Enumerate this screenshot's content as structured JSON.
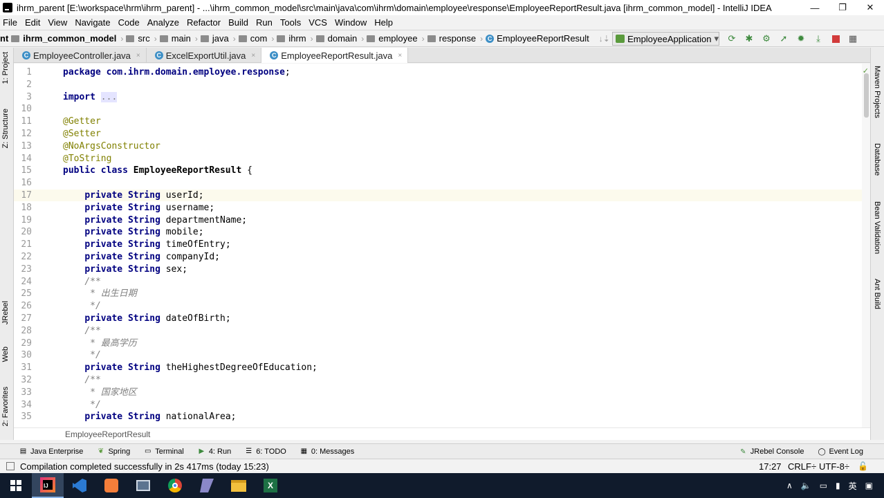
{
  "window": {
    "title": "ihrm_parent [E:\\workspace\\hrm\\ihrm_parent] - ...\\ihrm_common_model\\src\\main\\java\\com\\ihrm\\domain\\employee\\response\\EmployeeReportResult.java [ihrm_common_model] - IntelliJ IDEA",
    "minimize": "—",
    "restore": "❐",
    "close": "✕"
  },
  "menu": [
    "File",
    "Edit",
    "View",
    "Navigate",
    "Code",
    "Analyze",
    "Refactor",
    "Build",
    "Run",
    "Tools",
    "VCS",
    "Window",
    "Help"
  ],
  "nav": {
    "first": "nt",
    "module": "ihrm_common_model",
    "crumbs": [
      "src",
      "main",
      "java",
      "com",
      "ihrm",
      "domain",
      "employee",
      "response"
    ],
    "class": "EmployeeReportResult",
    "run_config": "EmployeeApplication"
  },
  "left_tabs": [
    "1: Project",
    "Z: Structure",
    "JRebel",
    "Web",
    "2: Favorites"
  ],
  "right_tabs": [
    "Maven Projects",
    "Database",
    "Bean Validation",
    "Ant Build"
  ],
  "tabs": [
    {
      "label": "EmployeeController.java",
      "active": false
    },
    {
      "label": "ExcelExportUtil.java",
      "active": false
    },
    {
      "label": "EmployeeReportResult.java",
      "active": true
    }
  ],
  "code": [
    {
      "n": "1",
      "parts": [
        [
          "kw",
          "package "
        ],
        [
          "kw",
          "com.ihrm.domain.employee.response"
        ],
        [
          "",
          "; "
        ]
      ]
    },
    {
      "n": "2",
      "parts": []
    },
    {
      "n": "3",
      "parts": [
        [
          "kw",
          "import "
        ],
        [
          "fold",
          "..."
        ]
      ]
    },
    {
      "n": "10",
      "parts": []
    },
    {
      "n": "11",
      "parts": [
        [
          "ann",
          "@Getter"
        ]
      ]
    },
    {
      "n": "12",
      "parts": [
        [
          "ann",
          "@Setter"
        ]
      ]
    },
    {
      "n": "13",
      "parts": [
        [
          "ann",
          "@NoArgsConstructor"
        ]
      ]
    },
    {
      "n": "14",
      "parts": [
        [
          "ann",
          "@ToString"
        ]
      ]
    },
    {
      "n": "15",
      "parts": [
        [
          "kw",
          "public class "
        ],
        [
          "b",
          "EmployeeReportResult"
        ],
        [
          "",
          " {"
        ]
      ]
    },
    {
      "n": "16",
      "parts": []
    },
    {
      "n": "17",
      "parts": [
        [
          "",
          "    "
        ],
        [
          "kw",
          "private "
        ],
        [
          "kw",
          "String "
        ],
        [
          "",
          "userId;"
        ]
      ],
      "current": true
    },
    {
      "n": "18",
      "parts": [
        [
          "",
          "    "
        ],
        [
          "kw",
          "private "
        ],
        [
          "kw",
          "String "
        ],
        [
          "",
          "username;"
        ]
      ]
    },
    {
      "n": "19",
      "parts": [
        [
          "",
          "    "
        ],
        [
          "kw",
          "private "
        ],
        [
          "kw",
          "String "
        ],
        [
          "",
          "departmentName;"
        ]
      ]
    },
    {
      "n": "20",
      "parts": [
        [
          "",
          "    "
        ],
        [
          "kw",
          "private "
        ],
        [
          "kw",
          "String "
        ],
        [
          "",
          "mobile;"
        ]
      ]
    },
    {
      "n": "21",
      "parts": [
        [
          "",
          "    "
        ],
        [
          "kw",
          "private "
        ],
        [
          "kw",
          "String "
        ],
        [
          "",
          "timeOfEntry;"
        ]
      ]
    },
    {
      "n": "22",
      "parts": [
        [
          "",
          "    "
        ],
        [
          "kw",
          "private "
        ],
        [
          "kw",
          "String "
        ],
        [
          "",
          "companyId;"
        ]
      ]
    },
    {
      "n": "23",
      "parts": [
        [
          "",
          "    "
        ],
        [
          "kw",
          "private "
        ],
        [
          "kw",
          "String "
        ],
        [
          "",
          "sex;"
        ]
      ]
    },
    {
      "n": "24",
      "parts": [
        [
          "",
          "    "
        ],
        [
          "cm",
          "/**"
        ]
      ]
    },
    {
      "n": "25",
      "parts": [
        [
          "",
          "     "
        ],
        [
          "cm",
          "* 出生日期"
        ]
      ]
    },
    {
      "n": "26",
      "parts": [
        [
          "",
          "     "
        ],
        [
          "cm",
          "*/"
        ]
      ]
    },
    {
      "n": "27",
      "parts": [
        [
          "",
          "    "
        ],
        [
          "kw",
          "private "
        ],
        [
          "kw",
          "String "
        ],
        [
          "",
          "dateOfBirth;"
        ]
      ]
    },
    {
      "n": "28",
      "parts": [
        [
          "",
          "    "
        ],
        [
          "cm",
          "/**"
        ]
      ]
    },
    {
      "n": "29",
      "parts": [
        [
          "",
          "     "
        ],
        [
          "cm",
          "* 最高学历"
        ]
      ]
    },
    {
      "n": "30",
      "parts": [
        [
          "",
          "     "
        ],
        [
          "cm",
          "*/"
        ]
      ]
    },
    {
      "n": "31",
      "parts": [
        [
          "",
          "    "
        ],
        [
          "kw",
          "private "
        ],
        [
          "kw",
          "String "
        ],
        [
          "",
          "theHighestDegreeOfEducation;"
        ]
      ]
    },
    {
      "n": "32",
      "parts": [
        [
          "",
          "    "
        ],
        [
          "cm",
          "/**"
        ]
      ]
    },
    {
      "n": "33",
      "parts": [
        [
          "",
          "     "
        ],
        [
          "cm",
          "* 国家地区"
        ]
      ]
    },
    {
      "n": "34",
      "parts": [
        [
          "",
          "     "
        ],
        [
          "cm",
          "*/"
        ]
      ]
    },
    {
      "n": "35",
      "parts": [
        [
          "",
          "    "
        ],
        [
          "kw",
          "private "
        ],
        [
          "kw",
          "String "
        ],
        [
          "",
          "nationalArea;"
        ]
      ]
    }
  ],
  "editor_breadcrumb": "EmployeeReportResult",
  "tool_windows": [
    {
      "label": "Java Enterprise",
      "icon": "java-enterprise-icon"
    },
    {
      "label": "Spring",
      "icon": "spring-icon"
    },
    {
      "label": "Terminal",
      "icon": "terminal-icon"
    },
    {
      "label": "4: Run",
      "icon": "run-icon"
    },
    {
      "label": "6: TODO",
      "icon": "todo-icon"
    },
    {
      "label": "0: Messages",
      "icon": "messages-icon"
    }
  ],
  "tool_windows_right": [
    {
      "label": "JRebel Console",
      "icon": "jrebel-icon"
    },
    {
      "label": "Event Log",
      "icon": "event-log-icon"
    }
  ],
  "status": {
    "message": "Compilation completed successfully in 2s 417ms (today 15:23)",
    "position": "17:27",
    "line_sep": "CRLF÷",
    "encoding": "UTF-8÷"
  },
  "tray": {
    "ime": "英"
  },
  "colors": {
    "keyword": "#000080",
    "annotation": "#808000",
    "comment": "#808080",
    "taskbar": "#101b2c"
  }
}
